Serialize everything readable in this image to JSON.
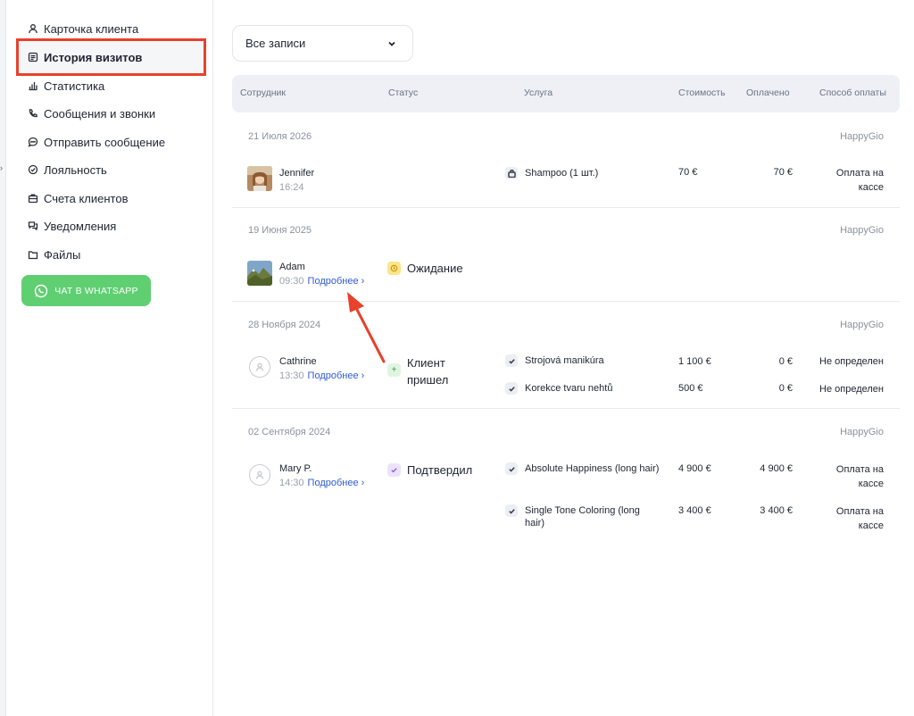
{
  "sidebar": {
    "items": [
      {
        "label": "Карточка клиента",
        "icon": "user-icon"
      },
      {
        "label": "История визитов",
        "icon": "history-icon",
        "active": true
      },
      {
        "label": "Статистика",
        "icon": "chart-icon"
      },
      {
        "label": "Сообщения и звонки",
        "icon": "phone-icon"
      },
      {
        "label": "Отправить сообщение",
        "icon": "chat-icon"
      },
      {
        "label": "Лояльность",
        "icon": "loyalty-icon"
      },
      {
        "label": "Счета клиентов",
        "icon": "briefcase-icon"
      },
      {
        "label": "Уведомления",
        "icon": "notifications-icon"
      },
      {
        "label": "Файлы",
        "icon": "folder-icon"
      }
    ],
    "whatsapp_label": "ЧАТ В WHATSAPP"
  },
  "filter": {
    "value": "Все записи"
  },
  "table": {
    "headers": {
      "employee": "Сотрудник",
      "status": "Статус",
      "service": "Услуга",
      "cost": "Стоимость",
      "paid": "Оплачено",
      "payment": "Способ оплаты"
    },
    "groups": [
      {
        "date": "21 Июля 2026",
        "salon": "HappyGio",
        "employee": "Jennifer",
        "time": "16:24",
        "link": "",
        "status": "",
        "services": [
          {
            "name": "Shampoo (1 шт.)",
            "cost": "70 €",
            "paid": "70 €",
            "payment": "Оплата на кассе"
          }
        ]
      },
      {
        "date": "19 Июня 2025",
        "salon": "HappyGio",
        "employee": "Adam",
        "time": "09:30",
        "link": "Подробнее",
        "status": "Ожидание",
        "services": []
      },
      {
        "date": "28 Ноября 2024",
        "salon": "HappyGio",
        "employee": "Cathrine",
        "time": "13:30",
        "link": "Подробнее",
        "status": "Клиент пришел",
        "services": [
          {
            "name": "Strojová manikúra",
            "cost": "1 100 €",
            "paid": "0 €",
            "payment": "Не определен"
          },
          {
            "name": "Korekce tvaru nehtů",
            "cost": "500 €",
            "paid": "0 €",
            "payment": "Не определен"
          }
        ]
      },
      {
        "date": "02 Сентября 2024",
        "salon": "HappyGio",
        "employee": "Mary P.",
        "time": "14:30",
        "link": "Подробнее",
        "status": "Подтвердил",
        "services": [
          {
            "name": "Absolute Happiness (long hair)",
            "cost": "4 900 €",
            "paid": "4 900 €",
            "payment": "Оплата на кассе"
          },
          {
            "name": "Single Tone Coloring (long hair)",
            "cost": "3 400 €",
            "paid": "3 400 €",
            "payment": "Оплата на кассе"
          }
        ]
      }
    ]
  },
  "colors": {
    "highlight": "#e8412c",
    "link": "#2f5bd3",
    "whatsapp": "#5fcf72",
    "status_waiting": "#fde58a",
    "status_arrived": "#dff5df",
    "status_confirmed": "#ece3fb"
  }
}
